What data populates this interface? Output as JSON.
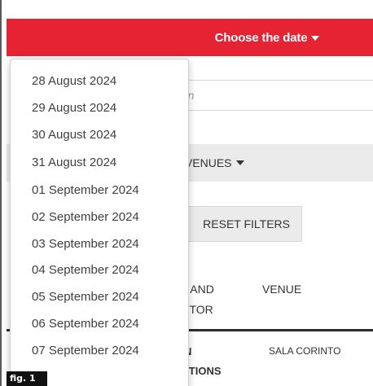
{
  "header": {
    "label": "Choose the date"
  },
  "search": {
    "placeholder_visible": "ection"
  },
  "venues": {
    "label": "LL VENUES"
  },
  "reset": {
    "label": "RESET FILTERS"
  },
  "table": {
    "headers": {
      "title": "LE AND\nECTOR",
      "venue": "VENUE"
    },
    "rows": [
      {
        "title": "AIN\nACTIONS",
        "venue": "SALA CORINTO"
      }
    ]
  },
  "dates": [
    "28 August 2024",
    "29 August 2024",
    "30 August 2024",
    "31 August 2024",
    "01 September 2024",
    "02 September 2024",
    "03 September 2024",
    "04 September 2024",
    "05 September 2024",
    "06 September 2024",
    "07 September 2024"
  ],
  "figure_label": "fig. 1",
  "colors": {
    "header_red": "#e52333",
    "button_grey": "#ebebeb"
  }
}
